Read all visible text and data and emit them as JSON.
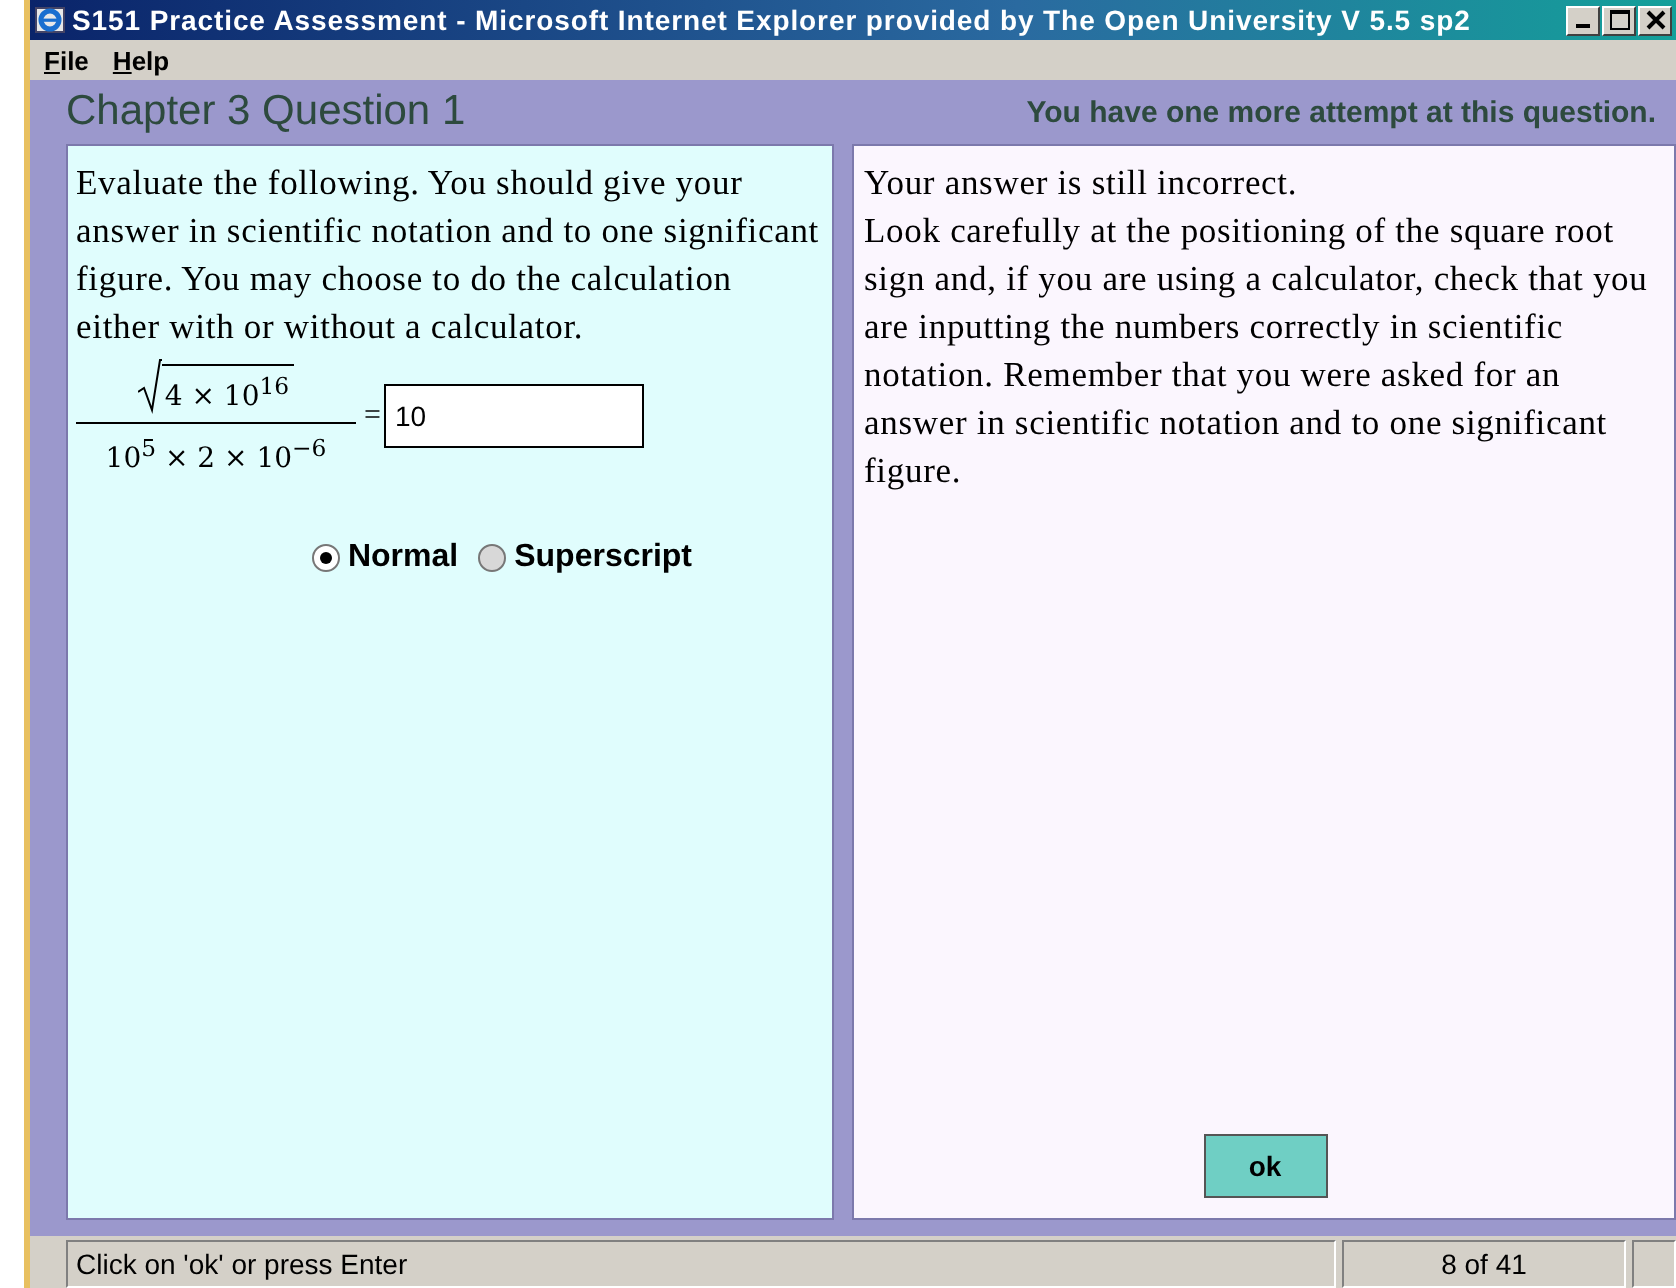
{
  "window": {
    "title": "S151 Practice Assessment - Microsoft Internet Explorer provided by The Open University V 5.5 sp2"
  },
  "menu": [
    {
      "label": "File"
    },
    {
      "label": "Help"
    }
  ],
  "header": {
    "title": "Chapter 3 Question 1",
    "attempts": "You have one more attempt at this question."
  },
  "question": {
    "text": "Evaluate the following. You should give your answer in scientific notation and to one significant figure. You may choose to do the calculation either with or without a calculator.",
    "formula": {
      "numerator": "4 × 10$^{16}$",
      "denominator": "10$^{5}$ × 2 × 10$^{−6}$",
      "equals": "="
    },
    "answer": {
      "value": "10"
    },
    "modes": [
      {
        "label": "Normal",
        "selected": true
      },
      {
        "label": "Superscript",
        "selected": false
      }
    ]
  },
  "feedback": {
    "lines": [
      "Your answer is still incorrect.",
      "Look carefully at the positioning of the square root sign and, if you are using a calculator, check that you are inputting the numbers correctly in scientific notation. Remember that you were asked for an answer in scientific notation and to one significant figure."
    ],
    "button": "ok"
  },
  "status_bar": {
    "message": "Click on 'ok' or press Enter",
    "progress": "8 of 41"
  }
}
